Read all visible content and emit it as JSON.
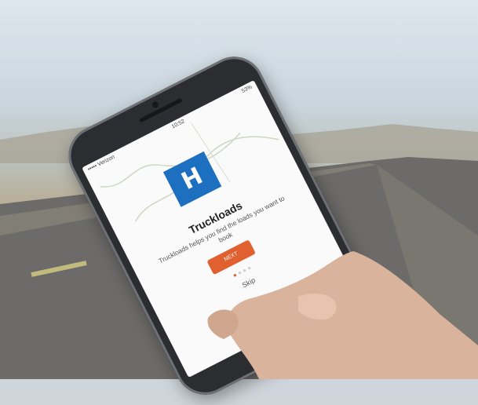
{
  "scene": {
    "sky_color": "#dfe7ee",
    "desert_color": "#c7b48e",
    "road_color": "#5e5f60",
    "phone_color": "#2b2d31"
  },
  "phone_screen": {
    "status": {
      "carrier": "••••• Verizon",
      "time": "10:52",
      "battery": "53%"
    },
    "app_title": "Truckloads",
    "description": "Truckloads helps you find the loads you want to book",
    "next_label": "NEXT",
    "skip_label": "Skip",
    "logo_glyph": "H",
    "brand_color": "#1d6fbf",
    "accent_color": "#e0612f",
    "page_dots": {
      "active": "●",
      "inactive": "●●●"
    }
  }
}
